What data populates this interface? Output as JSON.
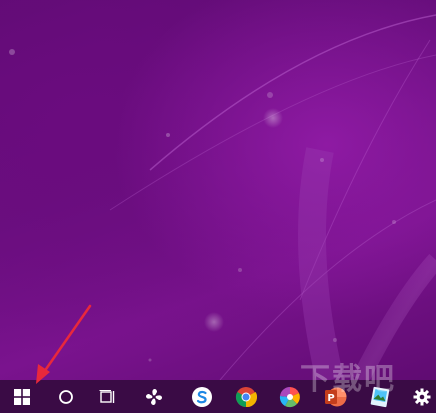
{
  "desktop": {
    "wallpaper": "purple-abstract-wallpaper",
    "accent": "#7a138e"
  },
  "taskbar": {
    "color": "#3a0b45",
    "items": [
      {
        "name": "start-button",
        "icon": "windows-logo-icon"
      },
      {
        "name": "cortana-search-button",
        "icon": "circle-icon"
      },
      {
        "name": "task-view-button",
        "icon": "task-view-icon"
      },
      {
        "name": "pinned-app-pinwheel",
        "icon": "pinwheel-icon"
      },
      {
        "name": "pinned-app-sogou",
        "icon": "sogou-s-icon"
      },
      {
        "name": "pinned-app-chrome",
        "icon": "chrome-icon"
      },
      {
        "name": "pinned-app-colorful",
        "icon": "colorful-ball-icon"
      },
      {
        "name": "pinned-app-powerpoint",
        "icon": "powerpoint-icon"
      },
      {
        "name": "pinned-app-image",
        "icon": "image-viewer-icon"
      },
      {
        "name": "settings-button",
        "icon": "gear-icon"
      }
    ]
  },
  "annotation": {
    "arrow_color": "#e8283c",
    "arrow_target": "start-button"
  },
  "watermark": {
    "text": "下载吧"
  }
}
